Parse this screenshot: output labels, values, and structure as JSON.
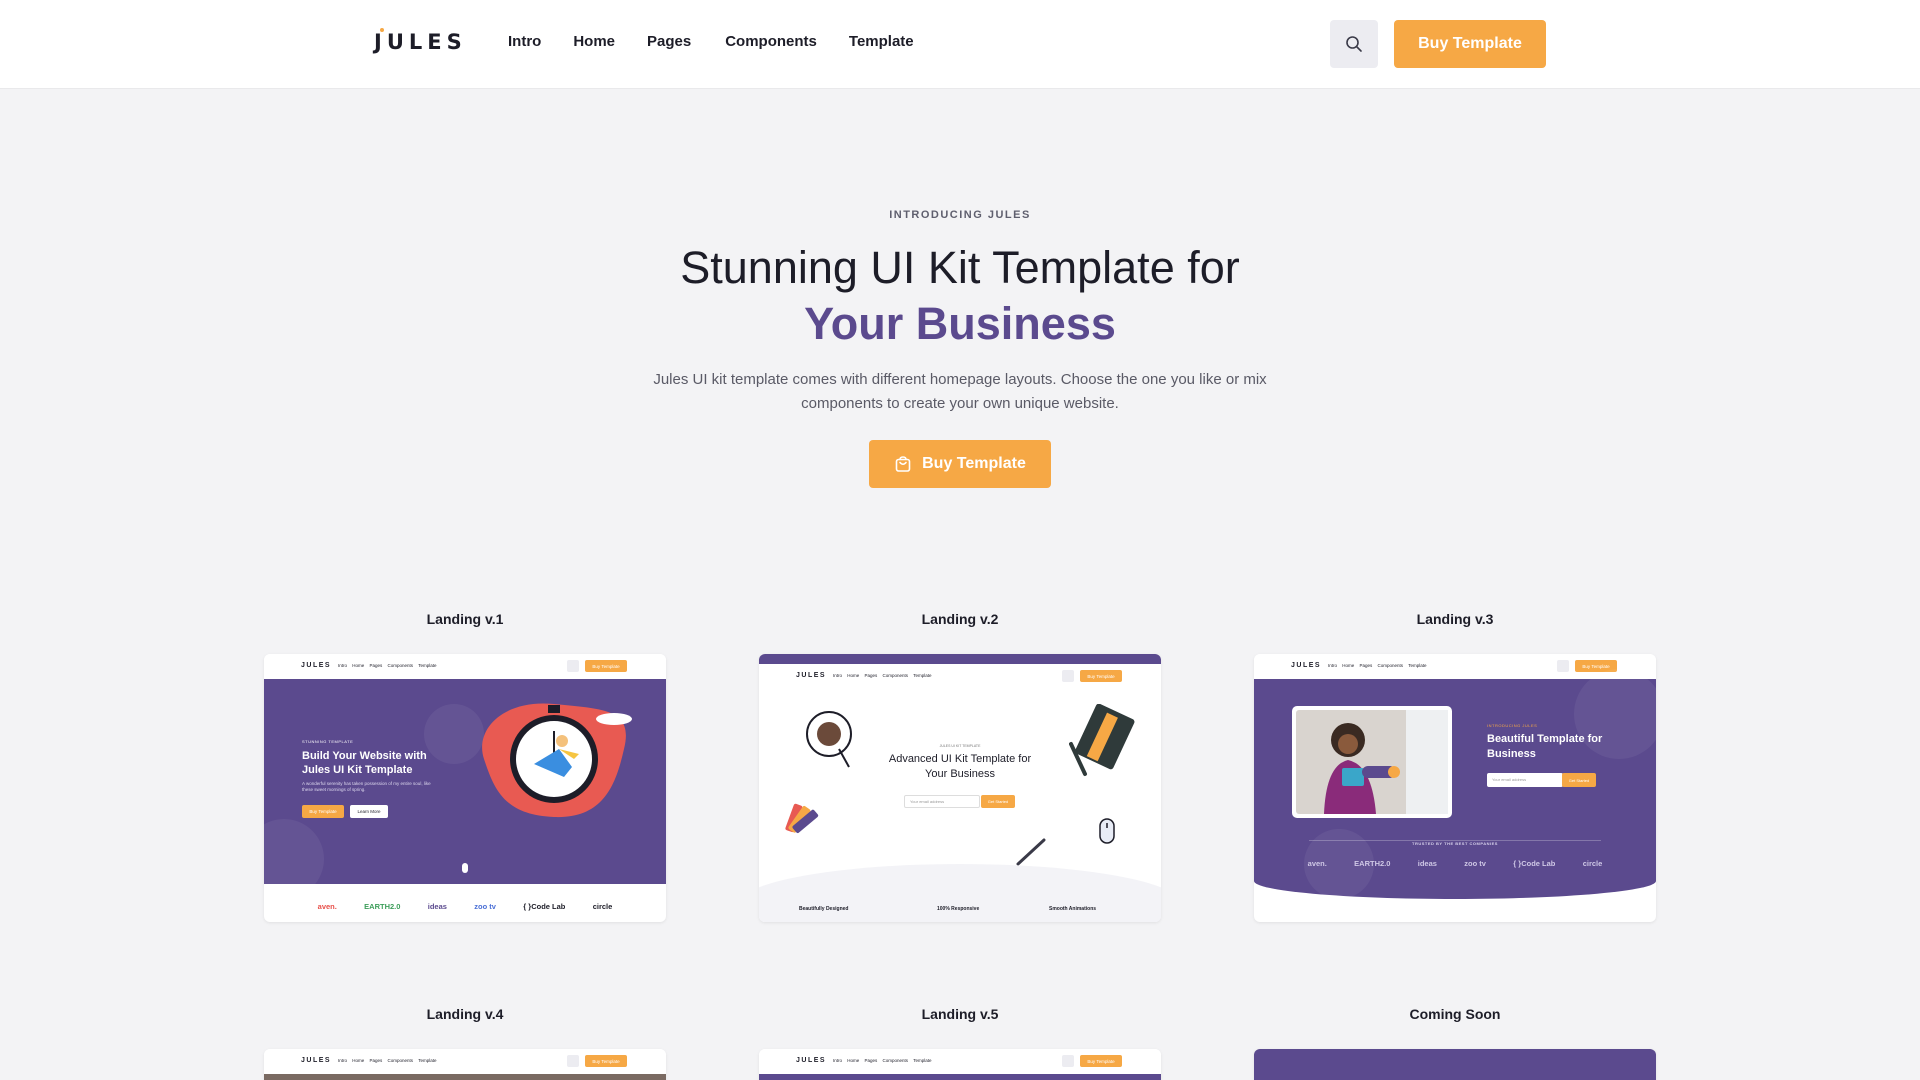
{
  "brand": {
    "logo": "JULES",
    "accent": "#f6a845",
    "purple": "#5b4a8e"
  },
  "header": {
    "nav": [
      "Intro",
      "Home",
      "Pages",
      "Components",
      "Template"
    ],
    "search_icon": "search-icon",
    "buy_label": "Buy Template"
  },
  "hero": {
    "eyebrow": "INTRODUCING JULES",
    "title_line1": "Stunning UI Kit Template for",
    "title_line2": "Your Business",
    "description": "Jules UI kit template comes with different homepage layouts. Choose the one you like or mix components to create your own unique website.",
    "cta_icon": "shopping-bag-icon",
    "cta_label": "Buy Template"
  },
  "cards": [
    {
      "title": "Landing v.1"
    },
    {
      "title": "Landing v.2"
    },
    {
      "title": "Landing v.3"
    },
    {
      "title": "Landing v.4"
    },
    {
      "title": "Landing v.5"
    },
    {
      "title": "Coming Soon"
    }
  ],
  "thumbs": {
    "mini_logo": "JULES",
    "mini_nav": "Intro Home Pages Components Template",
    "mini_buy": "Buy Template",
    "v1": {
      "eyebrow": "STUNNING TEMPLATE",
      "title": "Build Your Website with Jules UI Kit Template",
      "text": "A wonderful serenity has taken possession of my entire soul, like these sweet mornings of spring.",
      "btn1": "Buy Template",
      "btn2": "Learn More",
      "logos": [
        "aven.",
        "EARTH2.0",
        "ideas",
        "zoo tv",
        "{ }Code Lab",
        "circle"
      ]
    },
    "v2": {
      "eyebrow": "JULES UI KIT TEMPLATE",
      "title": "Advanced UI Kit Template for Your Business",
      "input": "Your email address",
      "btn": "Get Started",
      "features": [
        "Beautifully Designed",
        "100% Responsive",
        "Smooth Animations"
      ]
    },
    "v3": {
      "eyebrow": "INTRODUCING JULES",
      "title": "Beautiful Template for Business",
      "input": "Your email address",
      "btn": "Get Started",
      "trusted": "TRUSTED BY THE BEST COMPANIES",
      "logos": [
        "aven.",
        "EARTH2.0",
        "ideas",
        "zoo tv",
        "{ }Code Lab",
        "circle"
      ]
    }
  }
}
